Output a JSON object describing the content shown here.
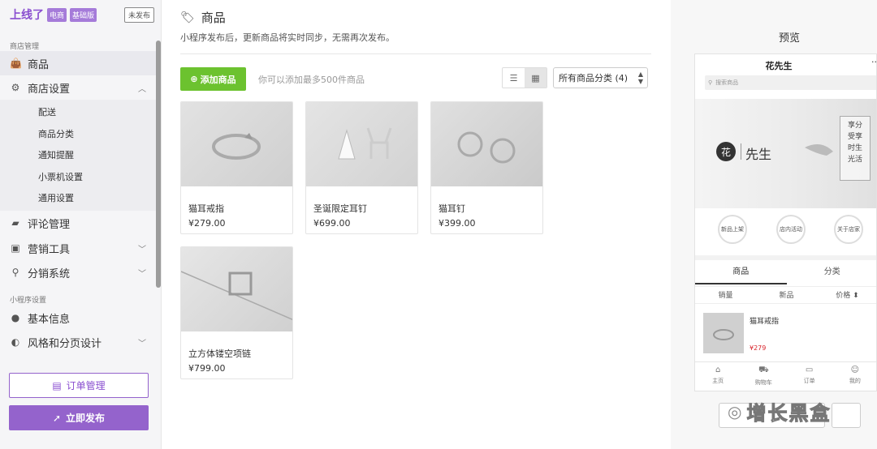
{
  "brand": {
    "logo": "上线了",
    "tag1": "电商",
    "tag2": "基础版",
    "status": "未发布"
  },
  "sidebar": {
    "section1": "商店管理",
    "items": {
      "goods": "商品",
      "store_settings": "商店设置",
      "reviews": "评论管理",
      "marketing": "营销工具",
      "distribution": "分销系统",
      "basic_info": "基本信息",
      "style": "风格和分页设计"
    },
    "sub_items": [
      "配送",
      "商品分类",
      "通知提醒",
      "小票机设置",
      "通用设置"
    ],
    "section2": "小程序设置",
    "order_btn": "订单管理",
    "publish_btn": "立即发布"
  },
  "main": {
    "title": "商品",
    "desc": "小程序发布后，更新商品将实时同步，无需再次发布。",
    "add_btn": "添加商品",
    "hint": "你可以添加最多500件商品",
    "category_select": "所有商品分类 (4)",
    "products": [
      {
        "name": "猫耳戒指",
        "price": "¥279.00"
      },
      {
        "name": "圣诞限定耳钉",
        "price": "¥699.00"
      },
      {
        "name": "猫耳钉",
        "price": "¥399.00"
      },
      {
        "name": "立方体镂空项链",
        "price": "¥799.00"
      }
    ]
  },
  "preview": {
    "title": "预览",
    "store_name": "花先生",
    "menu": "···",
    "search_placeholder": "搜索商品",
    "banner": {
      "logo": "花",
      "name": "先生",
      "poem": [
        "享分",
        "受享",
        "时生",
        "光活"
      ]
    },
    "circles": [
      [
        "新品",
        "上架"
      ],
      [
        "店内",
        "活动"
      ],
      [
        "关于",
        "店家"
      ]
    ],
    "tabs": [
      "商品",
      "分类"
    ],
    "sort": [
      "销量",
      "新品",
      "价格 ⬍"
    ],
    "product": {
      "name": "猫耳戒指",
      "price": "¥279"
    },
    "bottom": [
      "主页",
      "购物车",
      "订单",
      "我的"
    ]
  },
  "watermark": "增长黑盒",
  "colors": {
    "brand": "#8a4fd0",
    "add_green": "#6cc22f",
    "price_red": "#d8232a"
  }
}
